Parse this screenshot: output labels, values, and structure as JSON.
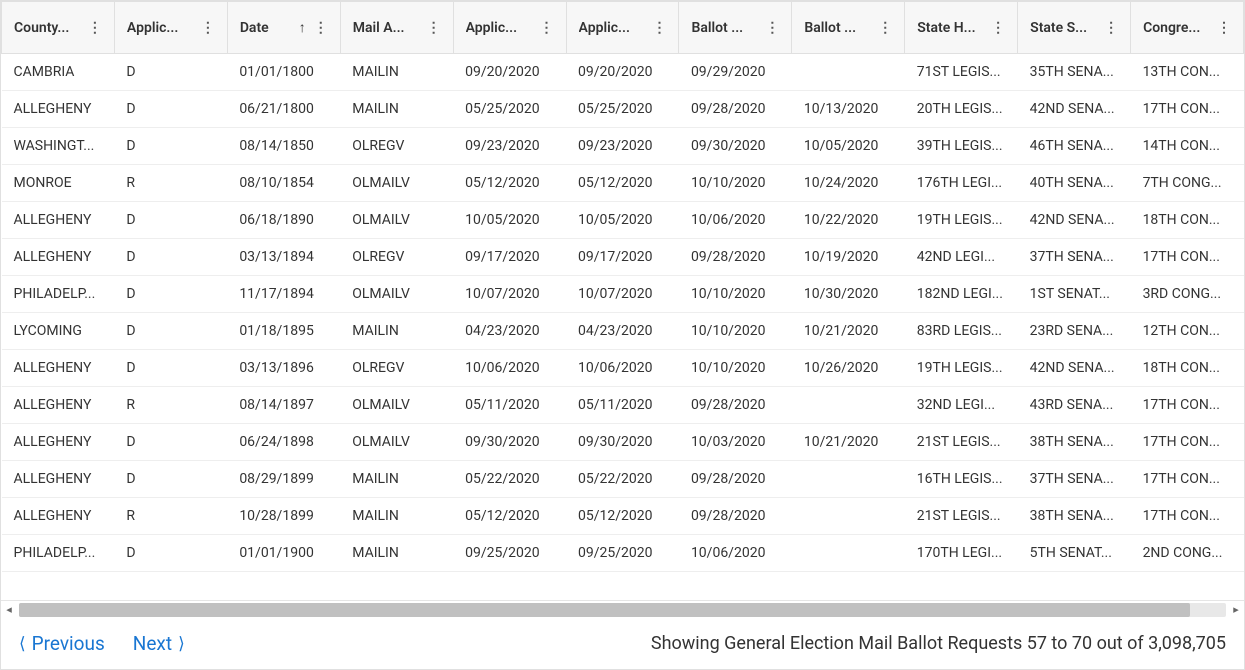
{
  "columns": [
    {
      "label": "County...",
      "sorted": false,
      "key": "county"
    },
    {
      "label": "Applic...",
      "sorted": false,
      "key": "applicant_party"
    },
    {
      "label": "Date",
      "sorted": true,
      "key": "date"
    },
    {
      "label": "Mail A...",
      "sorted": false,
      "key": "mail_app"
    },
    {
      "label": "Applic...",
      "sorted": false,
      "key": "app_date1"
    },
    {
      "label": "Applic...",
      "sorted": false,
      "key": "app_date2"
    },
    {
      "label": "Ballot ...",
      "sorted": false,
      "key": "ballot1"
    },
    {
      "label": "Ballot ...",
      "sorted": false,
      "key": "ballot2"
    },
    {
      "label": "State H...",
      "sorted": false,
      "key": "state_house"
    },
    {
      "label": "State S...",
      "sorted": false,
      "key": "state_senate"
    },
    {
      "label": "Congre...",
      "sorted": false,
      "key": "congress"
    }
  ],
  "rows": [
    [
      "CAMBRIA",
      "D",
      "01/01/1800",
      "MAILIN",
      "09/20/2020",
      "09/20/2020",
      "09/29/2020",
      "",
      "71ST LEGIS...",
      "35TH SENA...",
      "13TH CON..."
    ],
    [
      "ALLEGHENY",
      "D",
      "06/21/1800",
      "MAILIN",
      "05/25/2020",
      "05/25/2020",
      "09/28/2020",
      "10/13/2020",
      "20TH LEGIS...",
      "42ND SENA...",
      "17TH CON..."
    ],
    [
      "WASHINGT...",
      "D",
      "08/14/1850",
      "OLREGV",
      "09/23/2020",
      "09/23/2020",
      "09/30/2020",
      "10/05/2020",
      "39TH LEGIS...",
      "46TH SENA...",
      "14TH CON..."
    ],
    [
      "MONROE",
      "R",
      "08/10/1854",
      "OLMAILV",
      "05/12/2020",
      "05/12/2020",
      "10/10/2020",
      "10/24/2020",
      "176TH LEGI...",
      "40TH SENA...",
      "7TH CONG..."
    ],
    [
      "ALLEGHENY",
      "D",
      "06/18/1890",
      "OLMAILV",
      "10/05/2020",
      "10/05/2020",
      "10/06/2020",
      "10/22/2020",
      "19TH LEGIS...",
      "42ND SENA...",
      "18TH CON..."
    ],
    [
      "ALLEGHENY",
      "D",
      "03/13/1894",
      "OLREGV",
      "09/17/2020",
      "09/17/2020",
      "09/28/2020",
      "10/19/2020",
      "42ND LEGI...",
      "37TH SENA...",
      "17TH CON..."
    ],
    [
      "PHILADELP...",
      "D",
      "11/17/1894",
      "OLMAILV",
      "10/07/2020",
      "10/07/2020",
      "10/10/2020",
      "10/30/2020",
      "182ND LEGI...",
      "1ST SENAT...",
      "3RD CONG..."
    ],
    [
      "LYCOMING",
      "D",
      "01/18/1895",
      "MAILIN",
      "04/23/2020",
      "04/23/2020",
      "10/10/2020",
      "10/21/2020",
      "83RD LEGIS...",
      "23RD SENA...",
      "12TH CON..."
    ],
    [
      "ALLEGHENY",
      "D",
      "03/13/1896",
      "OLREGV",
      "10/06/2020",
      "10/06/2020",
      "10/10/2020",
      "10/26/2020",
      "19TH LEGIS...",
      "42ND SENA...",
      "18TH CON..."
    ],
    [
      "ALLEGHENY",
      "R",
      "08/14/1897",
      "OLMAILV",
      "05/11/2020",
      "05/11/2020",
      "09/28/2020",
      "",
      "32ND LEGI...",
      "43RD SENA...",
      "17TH CON..."
    ],
    [
      "ALLEGHENY",
      "D",
      "06/24/1898",
      "OLMAILV",
      "09/30/2020",
      "09/30/2020",
      "10/03/2020",
      "10/21/2020",
      "21ST LEGIS...",
      "38TH SENA...",
      "17TH CON..."
    ],
    [
      "ALLEGHENY",
      "D",
      "08/29/1899",
      "MAILIN",
      "05/22/2020",
      "05/22/2020",
      "09/28/2020",
      "",
      "16TH LEGIS...",
      "37TH SENA...",
      "17TH CON..."
    ],
    [
      "ALLEGHENY",
      "R",
      "10/28/1899",
      "MAILIN",
      "05/12/2020",
      "05/12/2020",
      "09/28/2020",
      "",
      "21ST LEGIS...",
      "38TH SENA...",
      "17TH CON..."
    ],
    [
      "PHILADELP...",
      "D",
      "01/01/1900",
      "MAILIN",
      "09/25/2020",
      "09/25/2020",
      "10/06/2020",
      "",
      "170TH LEGI...",
      "5TH SENAT...",
      "2ND CONG..."
    ]
  ],
  "pager": {
    "prev": "Previous",
    "next": "Next"
  },
  "status": "Showing General Election Mail Ballot Requests 57 to 70 out of 3,098,705"
}
